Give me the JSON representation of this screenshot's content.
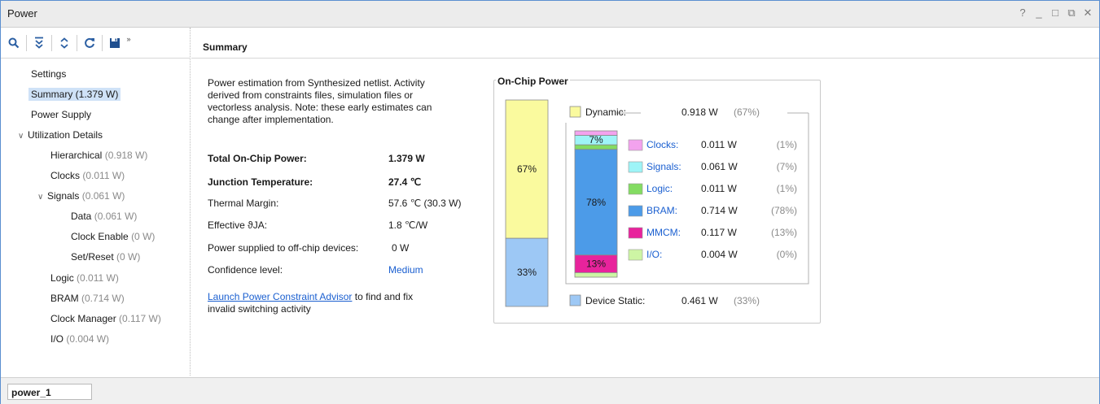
{
  "window": {
    "title": "Power",
    "controls": [
      "?",
      "_",
      "□",
      "⧉",
      "✕"
    ]
  },
  "toolbar": {
    "icons": [
      "search-icon",
      "collapse-all-icon",
      "expand-all-icon",
      "refresh-icon",
      "save-icon",
      "overflow-icon"
    ]
  },
  "summary_header": "Summary",
  "tree": {
    "settings": "Settings",
    "summary": "Summary (1.379 W)",
    "power_supply": "Power Supply",
    "utilization": "Utilization Details",
    "hierarchical": {
      "label": "Hierarchical",
      "value": "(0.918 W)"
    },
    "clocks": {
      "label": "Clocks",
      "value": "(0.011 W)"
    },
    "signals": {
      "label": "Signals",
      "value": "(0.061 W)"
    },
    "data": {
      "label": "Data",
      "value": "(0.061 W)"
    },
    "clock_enable": {
      "label": "Clock Enable",
      "value": "(0 W)"
    },
    "set_reset": {
      "label": "Set/Reset",
      "value": "(0 W)"
    },
    "logic": {
      "label": "Logic",
      "value": "(0.011 W)"
    },
    "bram": {
      "label": "BRAM",
      "value": "(0.714 W)"
    },
    "clock_manager": {
      "label": "Clock Manager",
      "value": "(0.117 W)"
    },
    "io": {
      "label": "I/O",
      "value": "(0.004 W)"
    }
  },
  "summary": {
    "description": [
      "Power estimation from Synthesized netlist. Activity",
      "derived from constraints files, simulation files or",
      "vectorless analysis. Note: these early estimates can",
      "change after implementation."
    ],
    "total_label": "Total On-Chip Power:",
    "total_value": "1.379 W",
    "junction_label": "Junction Temperature:",
    "junction_value": "27.4 ℃",
    "thermal_label": "Thermal Margin:",
    "thermal_value": "57.6 ℃ (30.3 W)",
    "theta_label": "Effective ϑJA:",
    "theta_value": "1.8 ℃/W",
    "offchip_label": "Power supplied to off-chip devices:",
    "offchip_value": "0 W",
    "confidence_label": "Confidence level:",
    "confidence_value": "Medium",
    "advisor_link": "Launch Power Constraint Advisor",
    "advisor_rest1": " to find and fix",
    "advisor_rest2": "invalid switching activity"
  },
  "chart_data": {
    "type": "bar",
    "title": "On-Chip Power",
    "total": {
      "segments": [
        {
          "name": "Dynamic",
          "watts": "0.918 W",
          "percent": "(67%)",
          "pct": 67,
          "label": "67%",
          "color": "#fafa9e"
        },
        {
          "name": "Device Static",
          "watts": "0.461 W",
          "percent": "(33%)",
          "pct": 33,
          "label": "33%",
          "color": "#9dc8f5"
        }
      ]
    },
    "dynamic_breakdown": [
      {
        "name": "Clocks",
        "watts": "0.011 W",
        "percent": "(1%)",
        "pct": 1,
        "color": "#f3a2ee",
        "bar_label": ""
      },
      {
        "name": "Signals",
        "watts": "0.061 W",
        "percent": "(7%)",
        "pct": 7,
        "color": "#9ef4f7",
        "bar_label": "7%"
      },
      {
        "name": "Logic",
        "watts": "0.011 W",
        "percent": "(1%)",
        "pct": 1,
        "color": "#83dc62",
        "bar_label": ""
      },
      {
        "name": "BRAM",
        "watts": "0.714 W",
        "percent": "(78%)",
        "pct": 78,
        "color": "#4c9be8",
        "bar_label": "78%"
      },
      {
        "name": "MMCM",
        "watts": "0.117 W",
        "percent": "(13%)",
        "pct": 13,
        "color": "#e8239c",
        "bar_label": "13%"
      },
      {
        "name": "I/O",
        "watts": "0.004 W",
        "percent": "(0%)",
        "pct": 0,
        "color": "#cdf5a4",
        "bar_label": ""
      }
    ]
  },
  "footer": {
    "tab": "power_1"
  }
}
